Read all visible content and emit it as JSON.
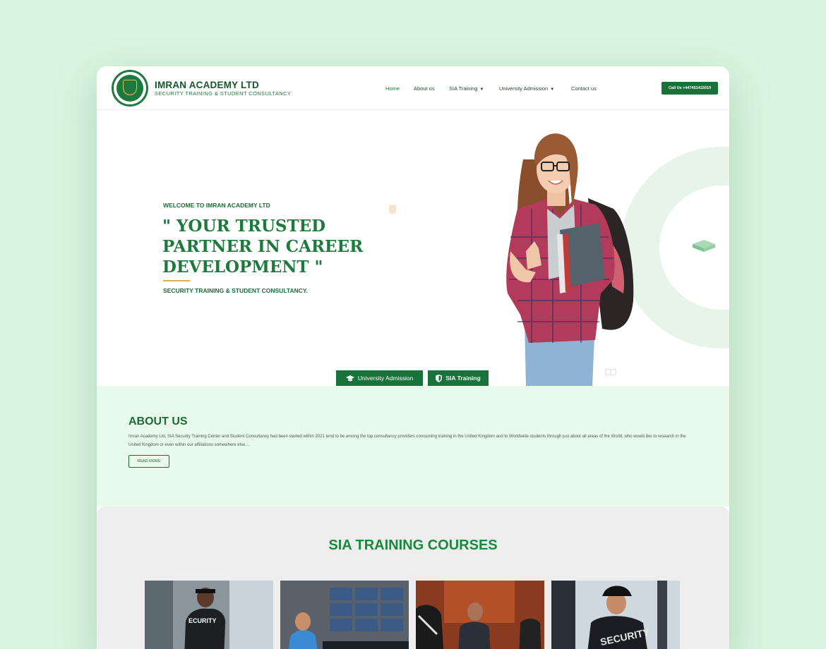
{
  "brand": {
    "title": "IMRAN ACADEMY LTD",
    "subtitle": "SECURITY TRAINING & STUDENT CONSULTANCY",
    "colors": {
      "primary": "#17733a",
      "dark": "#14572b",
      "accent": "#d6b44a",
      "mint": "#e8faeb"
    }
  },
  "nav": {
    "items": [
      {
        "label": "Home",
        "active": true,
        "dropdown": false
      },
      {
        "label": "About us",
        "active": false,
        "dropdown": false
      },
      {
        "label": "SIA Training",
        "active": false,
        "dropdown": true
      },
      {
        "label": "University Admission",
        "active": false,
        "dropdown": true
      },
      {
        "label": "Contact us",
        "active": false,
        "dropdown": false
      }
    ],
    "call_button": "Call Us +447451415019"
  },
  "hero": {
    "welcome": "WELCOME TO IMRAN ACADEMY LTD",
    "headline_lines": [
      "\" YOUR TRUSTED",
      "PARTNER IN CAREER",
      "DEVELOPMENT \""
    ],
    "subheading": "SECURITY TRAINING & STUDENT CONSULTANCY.",
    "buttons": [
      {
        "label": "University Admission",
        "icon": "graduation-cap-icon"
      },
      {
        "label": "SIA Training",
        "icon": "shield-icon"
      }
    ]
  },
  "about": {
    "title": "ABOUT US",
    "text": "Imran Academy Ltd, SIA Security Training Center and Student Consultancy had been started within 2021 tend to be among the top consultancy providers concerning training in the United Kingdom and to Worldwide students through just about all areas of the World, who would like to research in the United Kingdom or even within our affiliations somewhere else....",
    "button": "READ MORE"
  },
  "courses": {
    "title": "SIA TRAINING COURSES",
    "cards": [
      {
        "image": "security-guard-photo"
      },
      {
        "image": "cctv-operator-photo"
      },
      {
        "image": "door-supervisor-photo"
      },
      {
        "image": "security-officer-photo"
      }
    ]
  }
}
